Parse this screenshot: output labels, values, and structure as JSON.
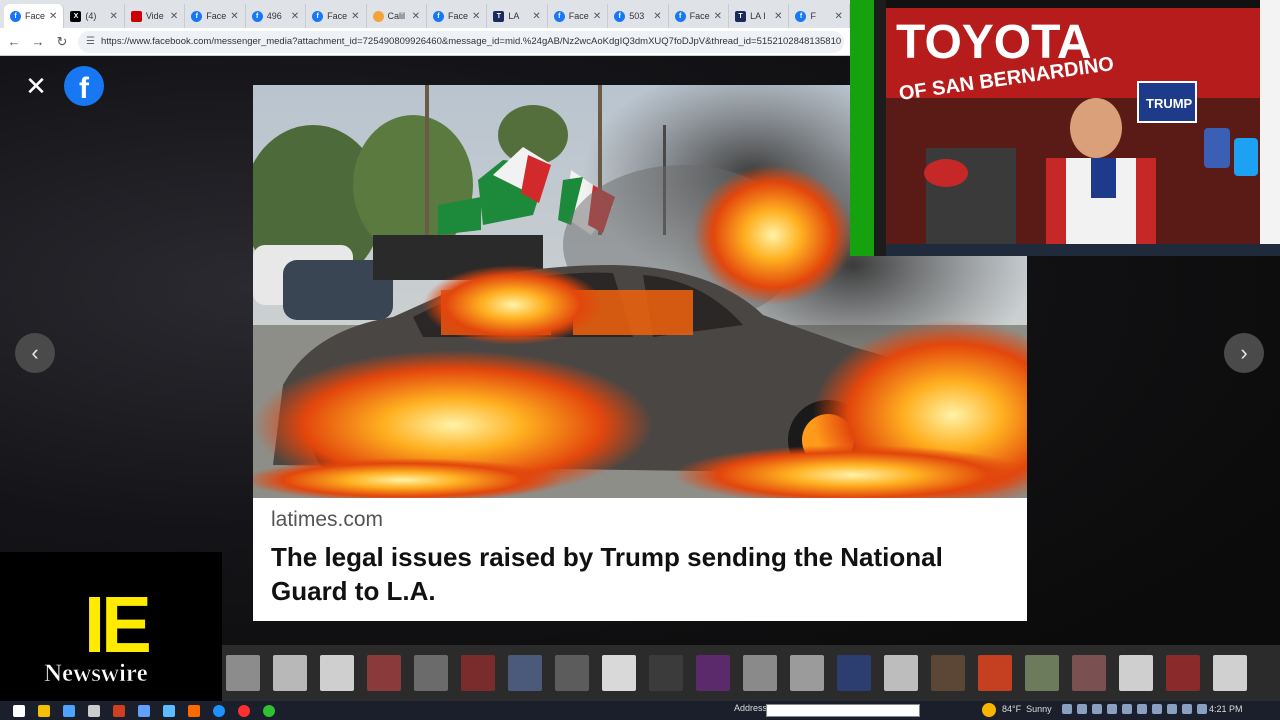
{
  "browser": {
    "tabs": [
      {
        "label": "Face",
        "icon": "facebook-icon",
        "active": true
      },
      {
        "label": "(4)",
        "icon": "x-icon",
        "active": false
      },
      {
        "label": "Vide",
        "icon": "cnn-icon",
        "active": false
      },
      {
        "label": "Face",
        "icon": "facebook-icon",
        "active": false
      },
      {
        "label": "496",
        "icon": "facebook-icon",
        "active": false
      },
      {
        "label": "Face",
        "icon": "facebook-icon",
        "active": false
      },
      {
        "label": "Calil",
        "icon": "calendar-icon",
        "active": false
      },
      {
        "label": "Face",
        "icon": "facebook-icon",
        "active": false
      },
      {
        "label": "LA",
        "icon": "latimes-icon",
        "active": false
      },
      {
        "label": "Face",
        "icon": "facebook-icon",
        "active": false
      },
      {
        "label": "503",
        "icon": "facebook-icon",
        "active": false
      },
      {
        "label": "Face",
        "icon": "facebook-icon",
        "active": false
      },
      {
        "label": "LA I",
        "icon": "latimes-icon",
        "active": false
      },
      {
        "label": "F",
        "icon": "facebook-icon",
        "active": false
      }
    ],
    "url": "https://www.facebook.com/messenger_media?attachment_id=725490809926460&message_id=mid.%24gAB/Nz2wcAoKdgIQ3dmXUQ7foDJpV&thread_id=5152102848135810"
  },
  "viewer": {
    "close_icon": "close-icon",
    "logo_letter": "f",
    "prev_glyph": "‹",
    "next_glyph": "›"
  },
  "link_card": {
    "domain": "latimes.com",
    "headline": "The legal issues raised by Trump sending the National Guard to L.A."
  },
  "webcam": {
    "banner_text": "TOYOTA",
    "banner_sub": "OF SAN BERNARDINO",
    "sign_text": "TRUMP"
  },
  "branding": {
    "logo_letters": "IE",
    "logo_word": "Newswire"
  },
  "taskbar": {
    "address_label": "Address",
    "temperature": "84°F",
    "condition": "Sunny",
    "time": "4:21 PM"
  },
  "colors": {
    "facebook_blue": "#1877f2",
    "logo_yellow": "#ffeb00",
    "green_screen": "#16a20f"
  }
}
